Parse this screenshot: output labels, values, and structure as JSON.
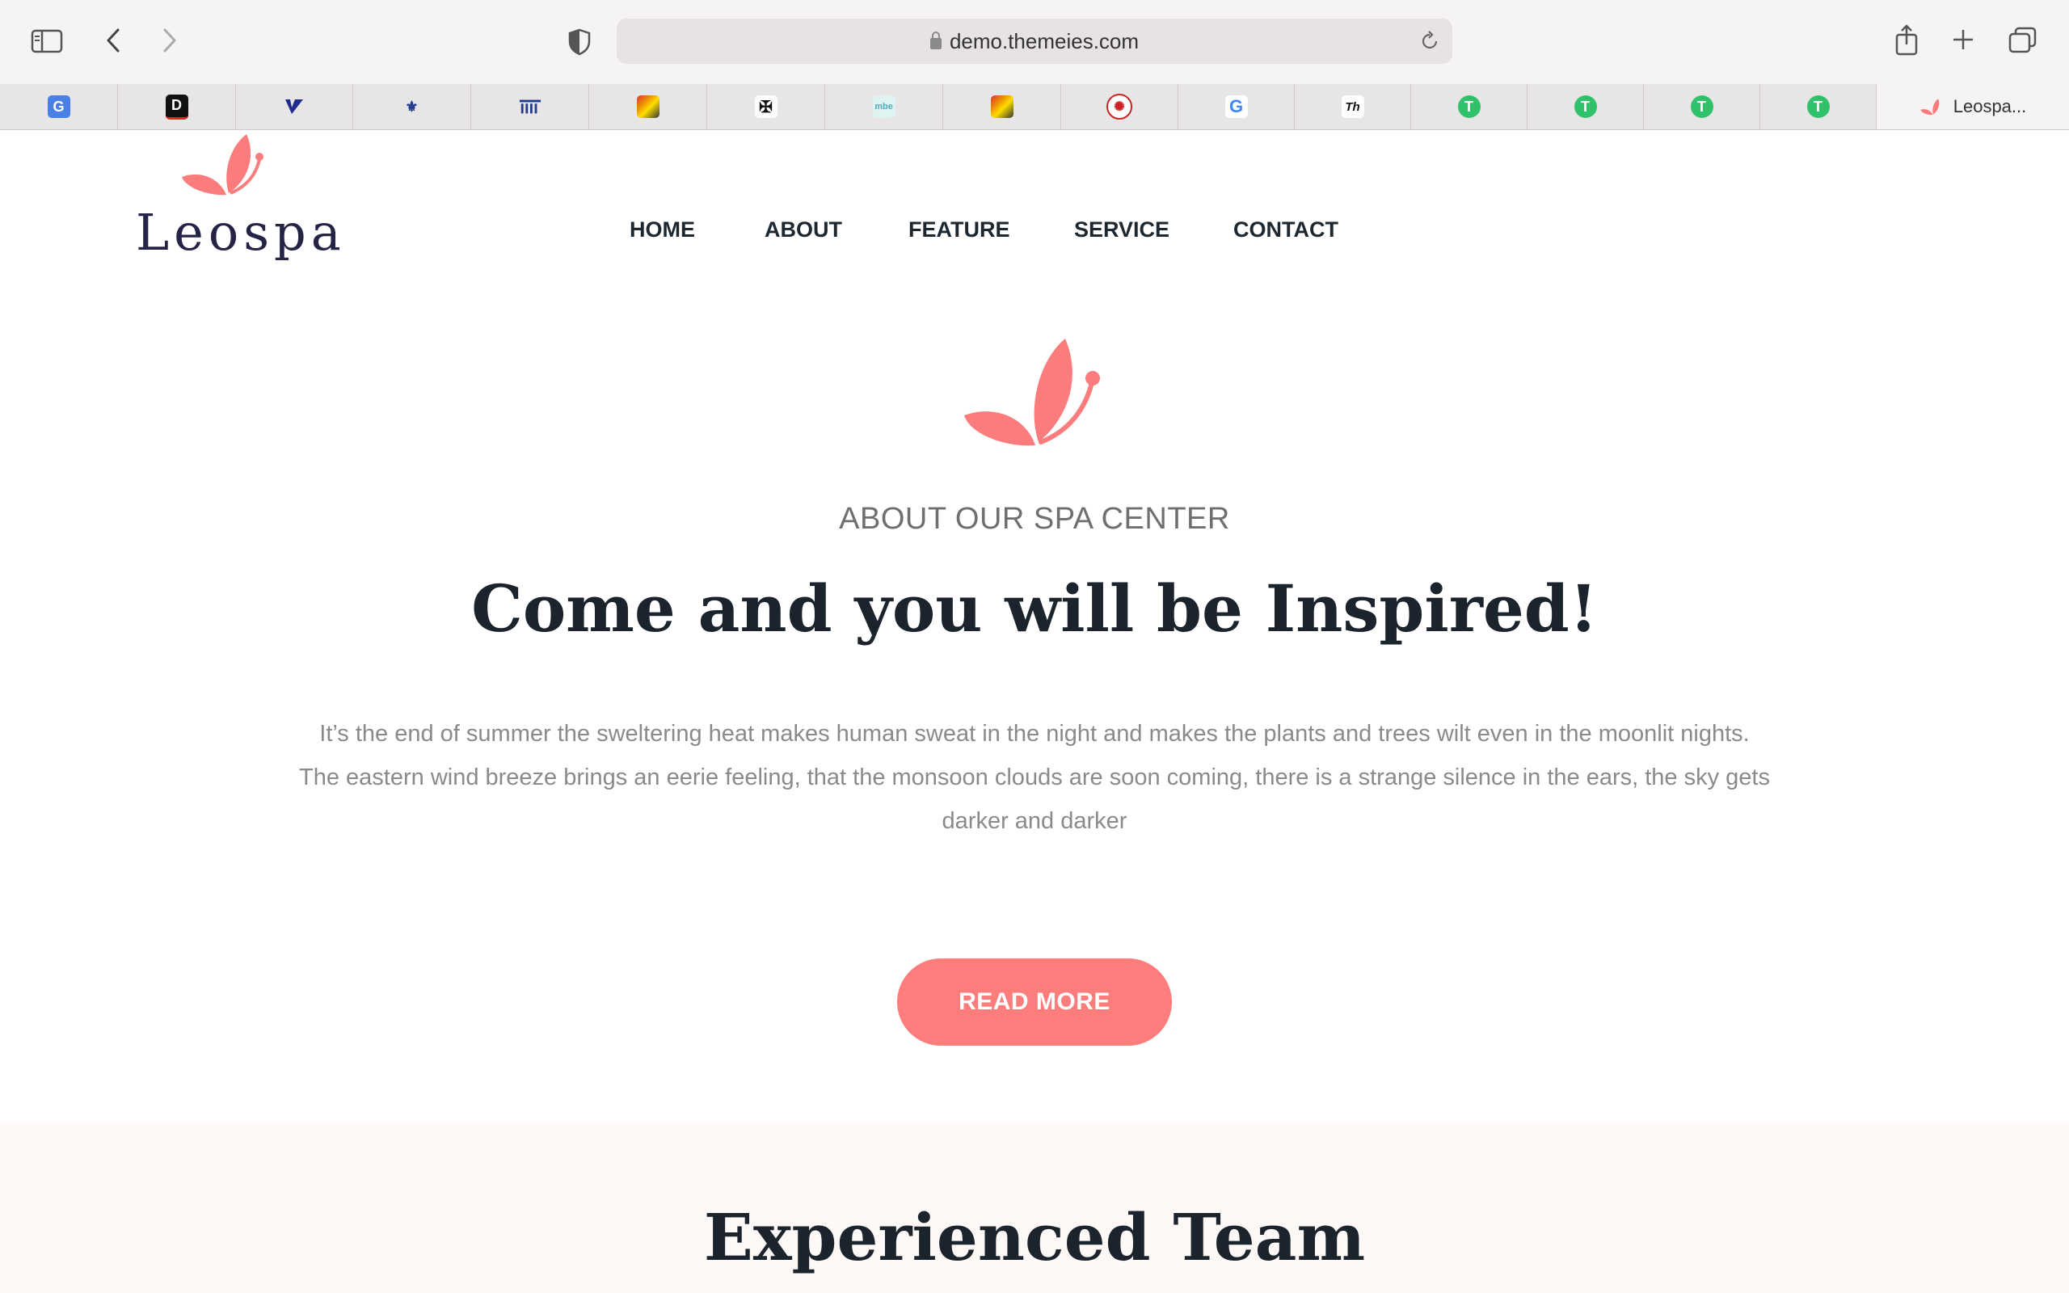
{
  "browser": {
    "url": "demo.themeies.com",
    "active_tab_title": "Leospa...",
    "tab_icons": [
      "translate-icon",
      "d-icon",
      "check-icon",
      "fleur-icon",
      "columns-icon",
      "grid-icon",
      "eagle-icon",
      "mbe-icon",
      "grid-icon",
      "seal-icon",
      "google-icon",
      "th-icon",
      "t-icon",
      "t-icon",
      "t-icon",
      "t-icon"
    ]
  },
  "site": {
    "logo": "Leospa",
    "nav": [
      "HOME",
      "ABOUT",
      "FEATURE",
      "SERVICE",
      "CONTACT"
    ]
  },
  "about": {
    "subtitle": "ABOUT OUR SPA CENTER",
    "title": "Come and you will be Inspired!",
    "body_line1": "It’s the end of summer the sweltering heat makes human sweat in the night and makes the plants and trees wilt even in the moonlit nights.",
    "body_line2": "The eastern wind breeze brings an eerie feeling, that the monsoon clouds are soon coming, there is a strange silence in the ears, the sky gets",
    "body_line3": "darker and darker",
    "button": "READ MORE"
  },
  "team": {
    "title": "Experienced Team"
  },
  "colors": {
    "accent": "#fd7d7d",
    "heading": "#1b232c",
    "body": "#8a8a8a",
    "section_bg": "#fef8f6"
  }
}
